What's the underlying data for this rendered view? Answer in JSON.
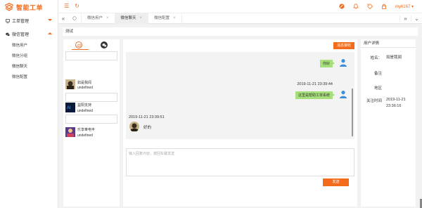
{
  "app": {
    "name": "智能工单"
  },
  "sidebar": {
    "groups": [
      {
        "label": "工单管理",
        "expanded": false
      },
      {
        "label": "微信管理",
        "expanded": true
      }
    ],
    "items": [
      {
        "label": "微信用户"
      },
      {
        "label": "微信分组"
      },
      {
        "label": "微信聊天"
      },
      {
        "label": "微信配置"
      }
    ]
  },
  "topbar": {
    "user": "my6167"
  },
  "tabs": [
    {
      "label": "微信用户"
    },
    {
      "label": "微信聊天",
      "active": true
    },
    {
      "label": "微信配置"
    }
  ],
  "page": {
    "title": "测试"
  },
  "contacts": [
    {
      "name": "如是我闻",
      "sub": "undefined"
    },
    {
      "name": "益阳支持",
      "sub": "undefined"
    },
    {
      "name": "乐享奉电丰",
      "sub": "undefined"
    }
  ],
  "chat": {
    "top_button": "消息接收",
    "messages": [
      {
        "side": "right",
        "text": "你好"
      },
      {
        "side": "right",
        "time": "2019-11-21 23:39:44",
        "text": "这里是帮助工单系统"
      },
      {
        "side": "left",
        "time": "2019-11-21 23:39:51",
        "text": "好的"
      }
    ],
    "input_placeholder": "输入回复内容，按回车键发送",
    "send_button": "发送"
  },
  "detail": {
    "title": "用户详情",
    "fields": [
      {
        "label": "姓名：",
        "value": "如是我闻"
      },
      {
        "label": "备注",
        "value": ""
      },
      {
        "label": "地区",
        "value": ""
      },
      {
        "label": "关注时间",
        "value": "2019-11-21 23:36:16"
      }
    ]
  },
  "colors": {
    "accent": "#f26c1c",
    "bubble": "#a7e07a"
  }
}
